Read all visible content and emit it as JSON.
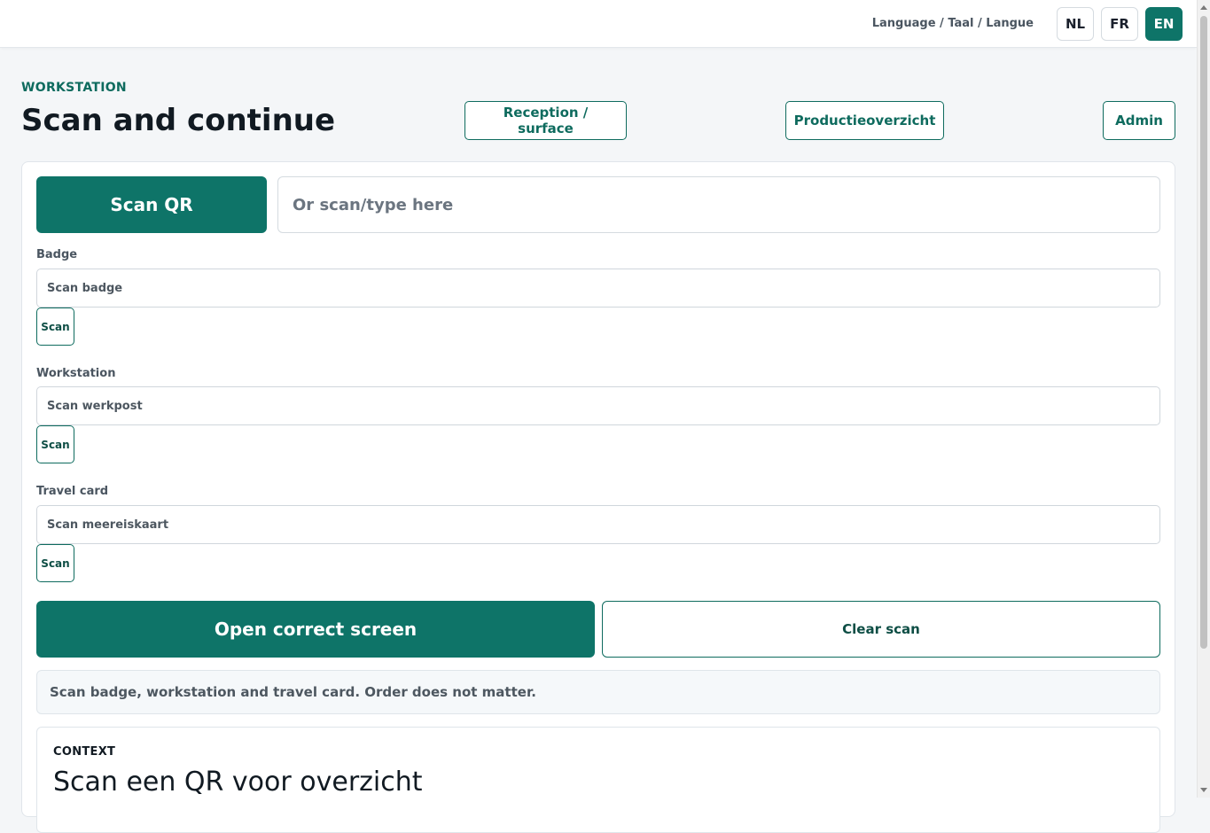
{
  "topbar": {
    "language_label": "Language / Taal / Langue",
    "languages": [
      {
        "code": "NL",
        "active": false
      },
      {
        "code": "FR",
        "active": false
      },
      {
        "code": "EN",
        "active": true
      }
    ]
  },
  "header": {
    "eyebrow": "WORKSTATION",
    "title": "Scan and continue",
    "nav": {
      "reception": "Reception / surface",
      "production": "Productieoverzicht",
      "admin": "Admin"
    }
  },
  "scanner": {
    "scan_qr_label": "Scan QR",
    "input_placeholder": "Or scan/type here",
    "input_value": ""
  },
  "fields": {
    "badge": {
      "label": "Badge",
      "placeholder": "Scan badge",
      "button": "Scan"
    },
    "workstation": {
      "label": "Workstation",
      "placeholder": "Scan werkpost",
      "button": "Scan"
    },
    "travel_card": {
      "label": "Travel card",
      "placeholder": "Scan meereiskaart",
      "button": "Scan"
    }
  },
  "actions": {
    "open_label": "Open correct screen",
    "clear_label": "Clear scan"
  },
  "hint": "Scan badge, workstation and travel card. Order does not matter.",
  "context": {
    "label": "CONTEXT",
    "title": "Scan een QR voor overzicht"
  },
  "colors": {
    "accent": "#0e7468",
    "accent_text": "#0e6b5e"
  }
}
